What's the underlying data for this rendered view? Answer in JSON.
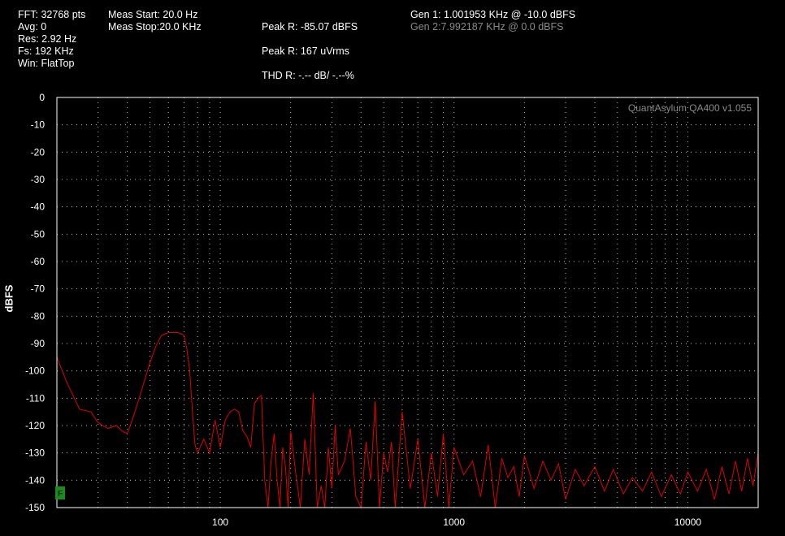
{
  "stats": {
    "fft": "FFT: 32768 pts",
    "avg": "Avg: 0",
    "res": "Res: 2.92 Hz",
    "fs": "Fs: 192 KHz",
    "win": "Win: FlatTop"
  },
  "meas": {
    "start": "Meas Start: 20.0 Hz",
    "stop": "Meas Stop:20.0 KHz"
  },
  "peaks": {
    "peak_dbfs": "Peak R: -85.07 dBFS",
    "peak_vrms": "Peak R: 167 uVrms",
    "thd": "THD R: -.-- dB/ -.--%"
  },
  "gens": {
    "gen1": "Gen 1: 1.001953 KHz @ -10.0  dBFS",
    "gen2": "Gen 2:7.992187 KHz @ 0.0  dBFS"
  },
  "watermark": "QuantAsylum QA400 v1.055",
  "marker_label": "F",
  "colors": {
    "trace": "#e00000",
    "grid": "#bbbbbb",
    "frame": "#ffffff",
    "marker": "#1a8a1a"
  },
  "chart_data": {
    "type": "line",
    "xlabel": "",
    "ylabel": "dBFS",
    "x_scale": "log",
    "xlim": [
      20,
      20000
    ],
    "ylim": [
      -150,
      0
    ],
    "yticks": [
      0,
      -10,
      -20,
      -30,
      -40,
      -50,
      -60,
      -70,
      -80,
      -90,
      -100,
      -110,
      -120,
      -130,
      -140,
      -150
    ],
    "xticks": [
      100,
      1000,
      10000
    ],
    "grid": true,
    "series": [
      {
        "color": "#e00000",
        "x": [
          20,
          22,
          25,
          28,
          30,
          33,
          36,
          38,
          40,
          42,
          45,
          48,
          50,
          53,
          56,
          60,
          63,
          66,
          70,
          72,
          74,
          76,
          78,
          80,
          85,
          90,
          95,
          100,
          105,
          110,
          115,
          120,
          125,
          130,
          135,
          140,
          145,
          150,
          155,
          160,
          165,
          170,
          175,
          180,
          185,
          190,
          195,
          200,
          210,
          220,
          230,
          240,
          250,
          260,
          270,
          280,
          290,
          300,
          310,
          320,
          340,
          360,
          380,
          400,
          420,
          440,
          460,
          480,
          500,
          520,
          540,
          560,
          600,
          650,
          700,
          750,
          800,
          850,
          900,
          950,
          1000,
          1100,
          1200,
          1300,
          1400,
          1500,
          1600,
          1700,
          1800,
          1900,
          2000,
          2200,
          2400,
          2600,
          2800,
          3000,
          3300,
          3600,
          4000,
          4400,
          4800,
          5300,
          5800,
          6400,
          7000,
          7700,
          8500,
          9300,
          10000,
          11000,
          12000,
          13000,
          14000,
          15000,
          16000,
          17000,
          18000,
          19000,
          20000
        ],
        "y": [
          -95,
          -104,
          -114,
          -115,
          -119,
          -121,
          -120,
          -122,
          -123,
          -118,
          -110,
          -102,
          -97,
          -91,
          -87,
          -86,
          -86,
          -86,
          -87,
          -92,
          -100,
          -115,
          -127,
          -130,
          -125,
          -130,
          -118,
          -128,
          -118,
          -115,
          -114,
          -115,
          -122,
          -124,
          -128,
          -112,
          -110,
          -109,
          -140,
          -150,
          -133,
          -123,
          -140,
          -150,
          -128,
          -135,
          -150,
          -122,
          -137,
          -150,
          -125,
          -138,
          -108,
          -150,
          -142,
          -150,
          -128,
          -143,
          -120,
          -138,
          -133,
          -121,
          -146,
          -150,
          -126,
          -140,
          -111,
          -150,
          -130,
          -137,
          -126,
          -150,
          -115,
          -143,
          -125,
          -150,
          -130,
          -146,
          -123,
          -150,
          -128,
          -138,
          -133,
          -146,
          -127,
          -150,
          -132,
          -139,
          -135,
          -146,
          -131,
          -143,
          -133,
          -140,
          -134,
          -147,
          -136,
          -142,
          -135,
          -144,
          -136,
          -145,
          -139,
          -144,
          -137,
          -146,
          -138,
          -145,
          -137,
          -144,
          -136,
          -147,
          -135,
          -145,
          -133,
          -144,
          -132,
          -142,
          -130
        ]
      }
    ]
  }
}
